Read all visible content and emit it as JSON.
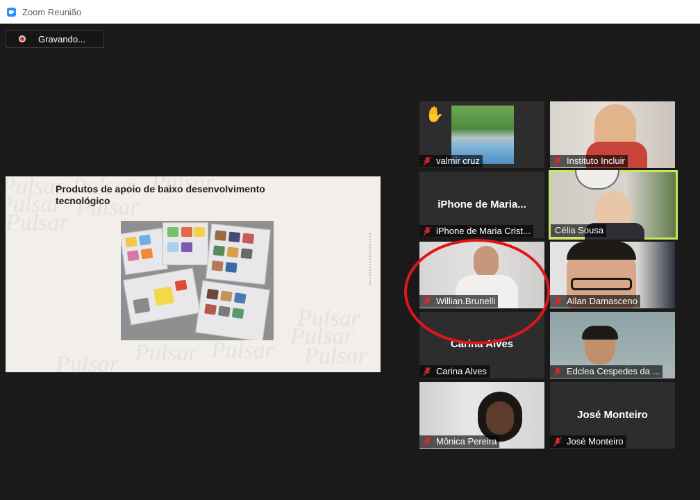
{
  "window": {
    "title": "Zoom Reunião"
  },
  "recording": {
    "label": "Gravando..."
  },
  "slide": {
    "title": "Produtos de apoio de baixo desenvolvimento tecnológico",
    "watermark": "Pulsar"
  },
  "participants": [
    {
      "name": "valmir cruz",
      "muted": true,
      "hand_raised": true
    },
    {
      "name": "Instituto Incluir",
      "muted": true
    },
    {
      "name": "iPhone de Maria Crist...",
      "display_name": "iPhone de Maria...",
      "muted": true
    },
    {
      "name": "Célia Sousa",
      "muted": false,
      "active_speaker": true
    },
    {
      "name": "Willian.Brunelli",
      "muted": true
    },
    {
      "name": "Allan Damasceno",
      "muted": true
    },
    {
      "name": "Carina Alves",
      "display_name": "Carina Alves",
      "muted": true
    },
    {
      "name": "Edclea Cespedes da ...",
      "muted": true
    },
    {
      "name": "Mônica Pereira",
      "muted": true
    },
    {
      "name": "José Monteiro",
      "display_name": "José Monteiro",
      "muted": true
    }
  ],
  "colors": {
    "active_speaker": "#c6e85a",
    "annotation_circle": "#e0151a",
    "muted_icon": "#e0262b",
    "zoom_blue": "#2d8cff"
  }
}
